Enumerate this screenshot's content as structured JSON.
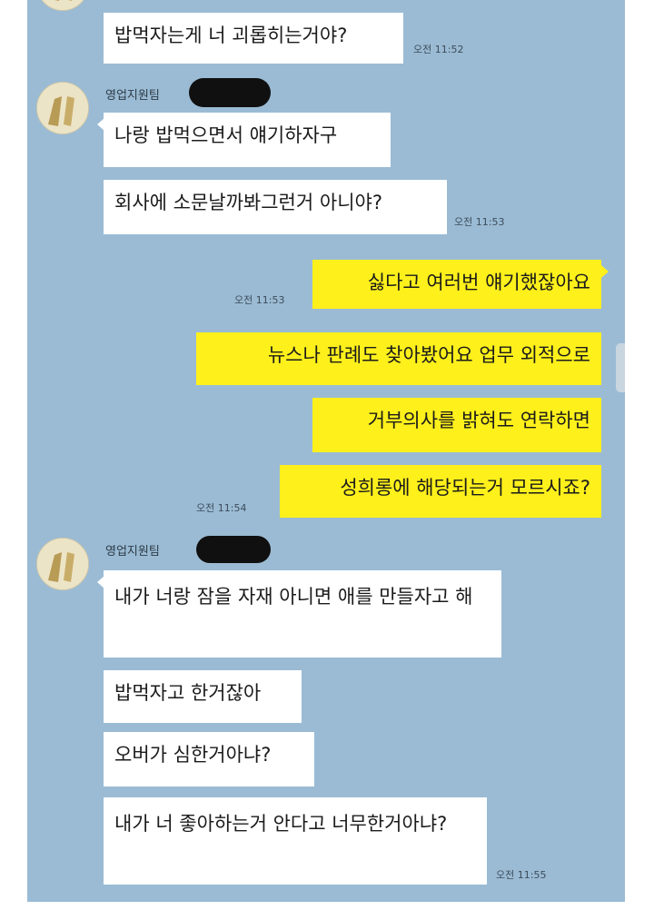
{
  "colors": {
    "chat_bg": "#9bbbd4",
    "my_bubble": "#fef01b",
    "their_bubble": "#ffffff"
  },
  "messages": [
    {
      "text": "밥먹자는게 너 괴롭히는거야?",
      "time": "오전 11:52"
    },
    {
      "sender": "영업지원팀",
      "text": "나랑 밥먹으면서 얘기하자구"
    },
    {
      "text": "회사에 소문날까봐그런거 아니야?",
      "time": "오전 11:53"
    },
    {
      "text": "싫다고 여러번 얘기했잖아요",
      "time": "오전 11:53"
    },
    {
      "text": "뉴스나 판례도 찾아봤어요 업무 외적으로"
    },
    {
      "text": "거부의사를 밝혀도 연락하면"
    },
    {
      "text": "성희롱에 해당되는거 모르시죠?",
      "time": "오전 11:54"
    },
    {
      "sender": "영업지원팀",
      "text": "내가 너랑 잠을 자재 아니면 애를 만들자고 해"
    },
    {
      "text": "밥먹자고 한거잖아"
    },
    {
      "text": "오버가 심한거아냐?"
    },
    {
      "text": "내가 너 좋아하는거 안다고 너무한거아냐?",
      "time": "오전 11:55"
    }
  ],
  "icons": {
    "avatar": "profile-avatar-icon",
    "redaction": "redacted-name-mark"
  }
}
